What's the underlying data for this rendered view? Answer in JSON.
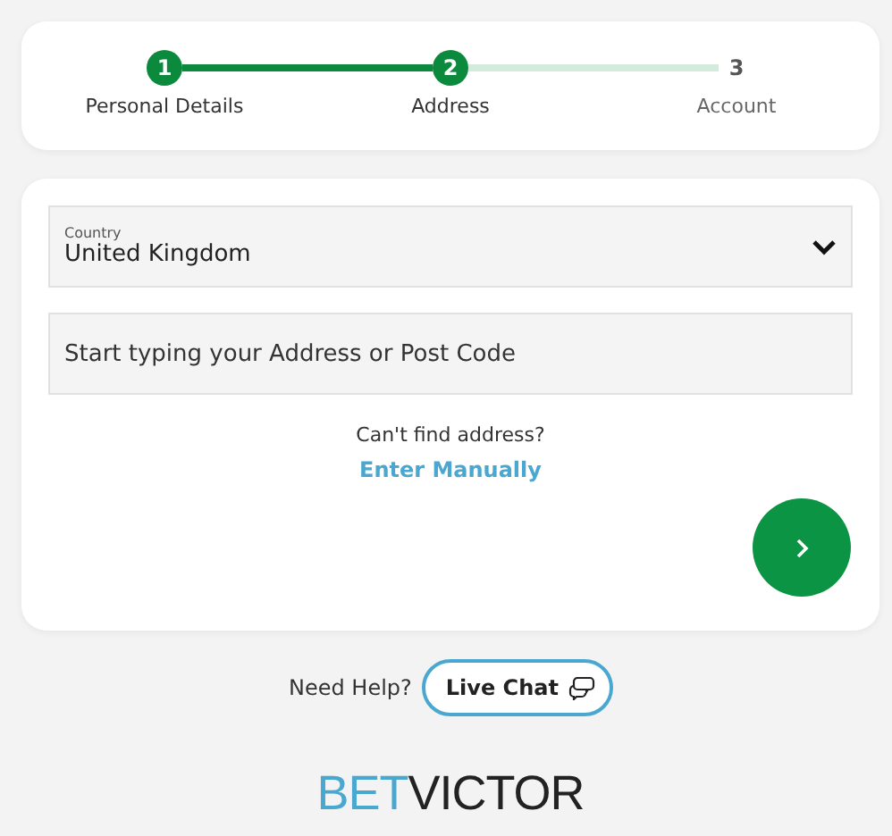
{
  "steps": [
    {
      "number": "1",
      "label": "Personal Details",
      "active": true
    },
    {
      "number": "2",
      "label": "Address",
      "active": true
    },
    {
      "number": "3",
      "label": "Account",
      "active": false
    }
  ],
  "country_field": {
    "label": "Country",
    "value": "United Kingdom"
  },
  "address_field": {
    "placeholder": "Start typing your Address or Post Code"
  },
  "hint": "Can't find address?",
  "manual_link": "Enter Manually",
  "help": {
    "text": "Need Help?",
    "button": "Live Chat"
  },
  "logo": {
    "part_1": "BET",
    "part_2": "VICTOR"
  }
}
